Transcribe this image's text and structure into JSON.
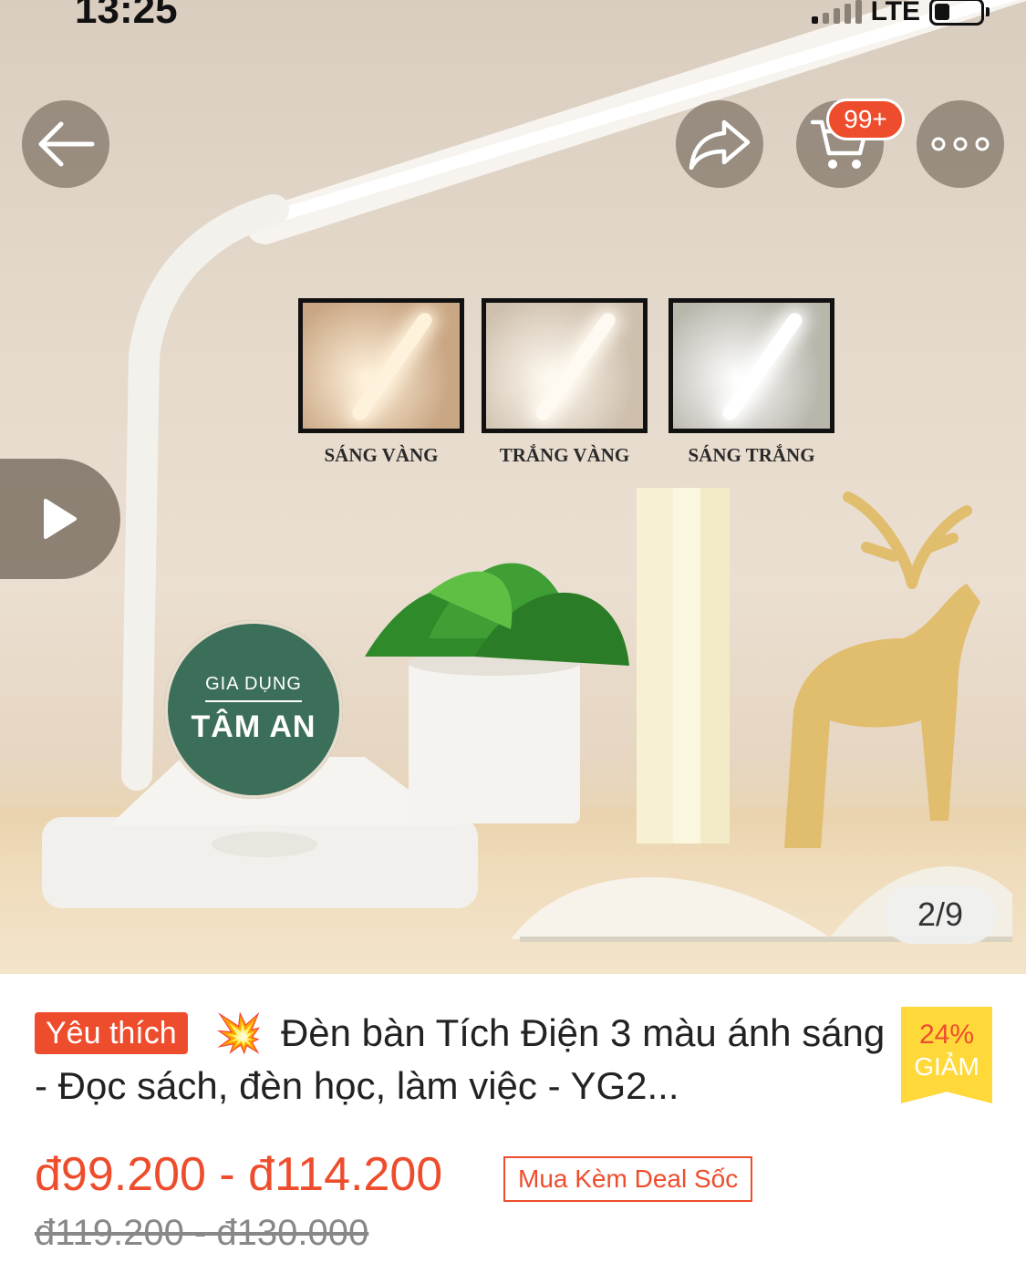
{
  "status_bar": {
    "time": "13:25",
    "network": "LTE"
  },
  "top_actions": {
    "cart_badge": "99+"
  },
  "image": {
    "swatches": [
      {
        "label": "SÁNG VÀNG",
        "bg": "#c9a684",
        "bar": "#fff2dc"
      },
      {
        "label": "TRẮNG VÀNG",
        "bg": "#cfc0ae",
        "bar": "#fffaf1"
      },
      {
        "label": "SÁNG TRẮNG",
        "bg": "#b9b6ac",
        "bar": "#ffffff"
      }
    ],
    "logo_line1": "GIA DỤNG",
    "logo_line2": "TÂM AN",
    "page_counter": "2/9"
  },
  "product": {
    "tag": "Yêu thích",
    "title": "Đèn bàn Tích Điện 3 màu ánh sáng - Đọc sách, đèn học, làm việc - YG2...",
    "discount_percent": "24%",
    "discount_label": "GIẢM",
    "price_range": "đ99.200 - đ114.200",
    "deal_label": "Mua Kèm Deal Sốc",
    "original_price": "đ119.200 - đ130.000"
  },
  "colors": {
    "accent": "#ee4d2d",
    "discount_bg": "#ffd839"
  }
}
